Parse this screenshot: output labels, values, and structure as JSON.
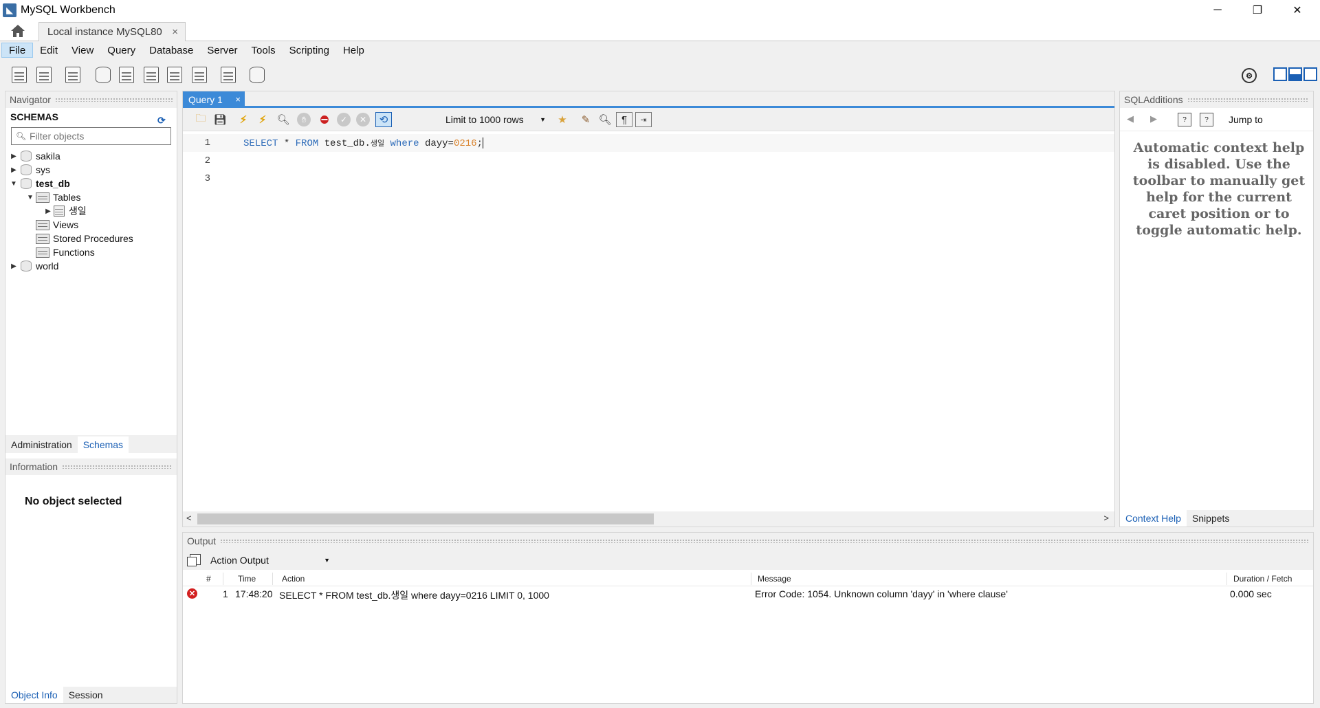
{
  "window": {
    "title": "MySQL Workbench",
    "minimize": "─",
    "maximize": "❐",
    "close": "✕"
  },
  "connection_tab": {
    "label": "Local instance MySQL80",
    "close": "×"
  },
  "menu": [
    "File",
    "Edit",
    "View",
    "Query",
    "Database",
    "Server",
    "Tools",
    "Scripting",
    "Help"
  ],
  "navigator": {
    "header": "Navigator",
    "schemas_label": "SCHEMAS",
    "filter_placeholder": "Filter objects",
    "tree": {
      "sakila": "sakila",
      "sys": "sys",
      "test_db": "test_db",
      "tables": "Tables",
      "table_saengil": "생일",
      "views": "Views",
      "stored_procedures": "Stored Procedures",
      "functions": "Functions",
      "world": "world"
    },
    "bottom_tabs": {
      "administration": "Administration",
      "schemas": "Schemas"
    },
    "information_header": "Information",
    "no_object": "No object selected",
    "info_tabs": {
      "object_info": "Object Info",
      "session": "Session"
    }
  },
  "editor": {
    "tab_label": "Query 1",
    "tab_close": "×",
    "limit_select": "Limit to 1000 rows",
    "line_numbers": [
      "1",
      "2",
      "3"
    ],
    "code": {
      "select": "SELECT",
      "star": " * ",
      "from": "FROM",
      "table_ref": " test_db.",
      "table_name": "생일",
      "where": " where ",
      "column": "dayy=",
      "number": "0216",
      "semicolon": ";"
    }
  },
  "additions": {
    "header": "SQLAdditions",
    "jump_to": "Jump to",
    "context_help_text": "Automatic context help is disabled. Use the toolbar to manually get help for the current caret position or to toggle automatic help.",
    "tabs": {
      "context_help": "Context Help",
      "snippets": "Snippets"
    }
  },
  "output": {
    "header": "Output",
    "select_value": "Action Output",
    "columns": {
      "num": "#",
      "time": "Time",
      "action": "Action",
      "message": "Message",
      "duration": "Duration / Fetch"
    },
    "rows": [
      {
        "num": "1",
        "time": "17:48:20",
        "action": "SELECT * FROM test_db.생일 where dayy=0216 LIMIT 0, 1000",
        "message": "Error Code: 1054. Unknown column 'dayy' in 'where clause'",
        "duration": "0.000 sec",
        "status": "error"
      }
    ]
  },
  "colors": {
    "accent": "#3c8ad8",
    "keyword": "#2b6ab8",
    "number": "#d9822b",
    "error": "#d32020"
  }
}
